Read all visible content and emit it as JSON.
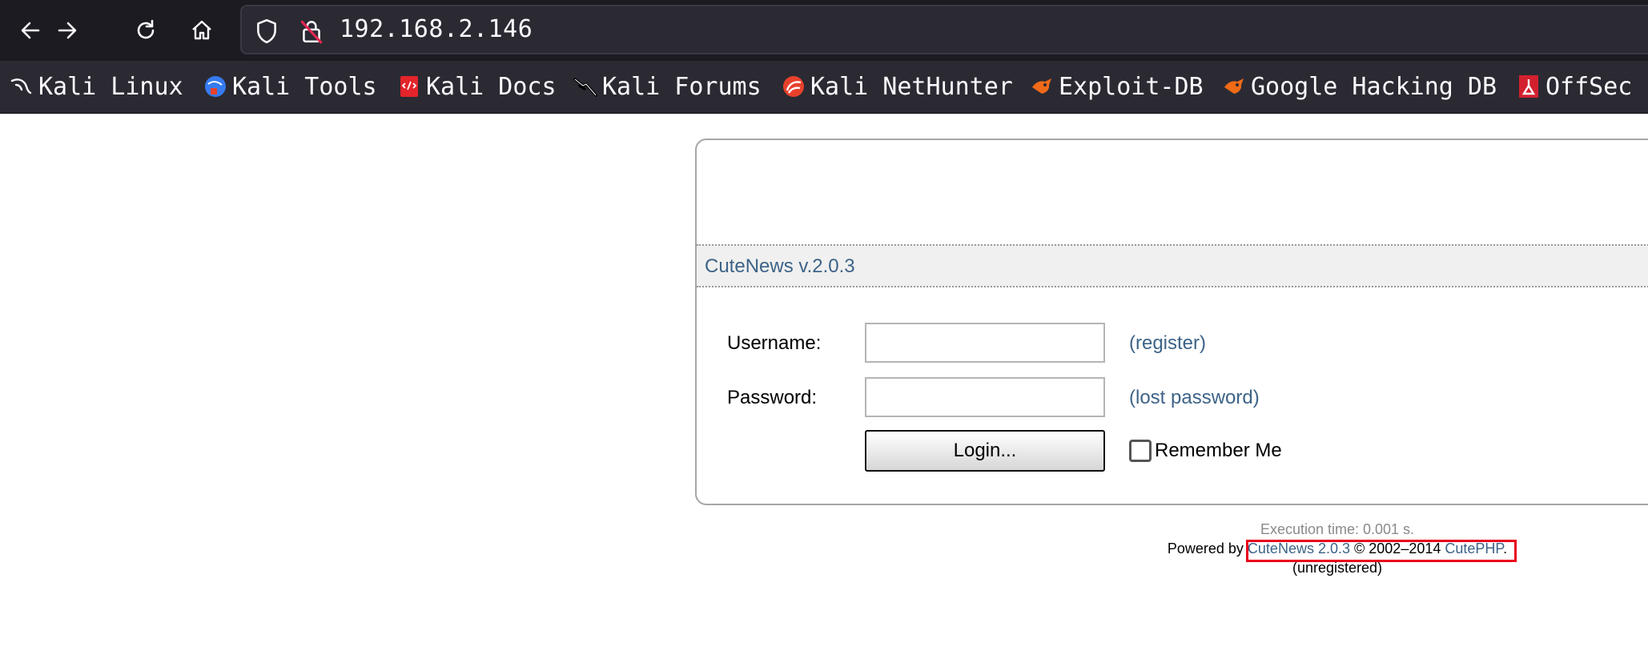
{
  "browser": {
    "url": "192.168.2.146",
    "bookmarks": [
      {
        "label": "Kali Linux",
        "icon": "kali-dragon-icon"
      },
      {
        "label": "Kali Tools",
        "icon": "kali-tools-icon"
      },
      {
        "label": "Kali Docs",
        "icon": "kali-docs-icon"
      },
      {
        "label": "Kali Forums",
        "icon": "kali-forums-icon"
      },
      {
        "label": "Kali NetHunter",
        "icon": "nethunter-icon"
      },
      {
        "label": "Exploit-DB",
        "icon": "exploit-db-icon"
      },
      {
        "label": "Google Hacking DB",
        "icon": "ghdb-icon"
      },
      {
        "label": "OffSec",
        "icon": "offsec-icon"
      }
    ]
  },
  "login": {
    "version": "CuteNews v.2.0.3",
    "username_label": "Username:",
    "password_label": "Password:",
    "username_value": "",
    "password_value": "",
    "register_link": "(register)",
    "lost_password_link": "(lost password)",
    "login_button": "Login...",
    "remember_label": "Remember Me",
    "remember_checked": false
  },
  "footer": {
    "execution_time": "Execution time: 0.001 s.",
    "powered_by": "Powered by",
    "product_link": "CuteNews 2.0.3",
    "copyright": "© 2002–2014",
    "company_link": "CutePHP",
    "period": ".",
    "status": "(unregistered)"
  },
  "colors": {
    "link": "#3d6387",
    "highlight": "#e8001c",
    "chrome_dark": "#1c1b22"
  }
}
